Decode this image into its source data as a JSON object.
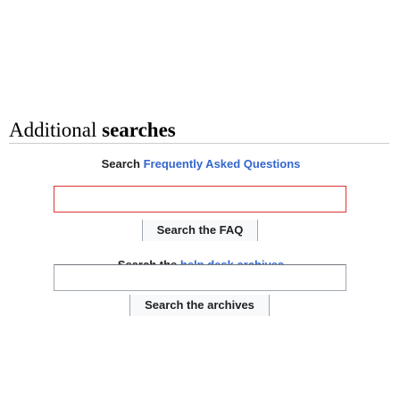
{
  "section": {
    "heading_part1": "Additional ",
    "heading_part2": "searches"
  },
  "faq": {
    "label_prefix": "Search ",
    "label_link": "Frequently Asked Questions",
    "input_value": "",
    "button_label": "Search the FAQ"
  },
  "archives": {
    "label_prefix": "Search the ",
    "label_link": "help desk archives",
    "input_value": "",
    "button_label": "Search the archives"
  },
  "colors": {
    "link": "#3366cc",
    "error_border": "#dd3333",
    "button_bg": "#f8f9fa"
  }
}
